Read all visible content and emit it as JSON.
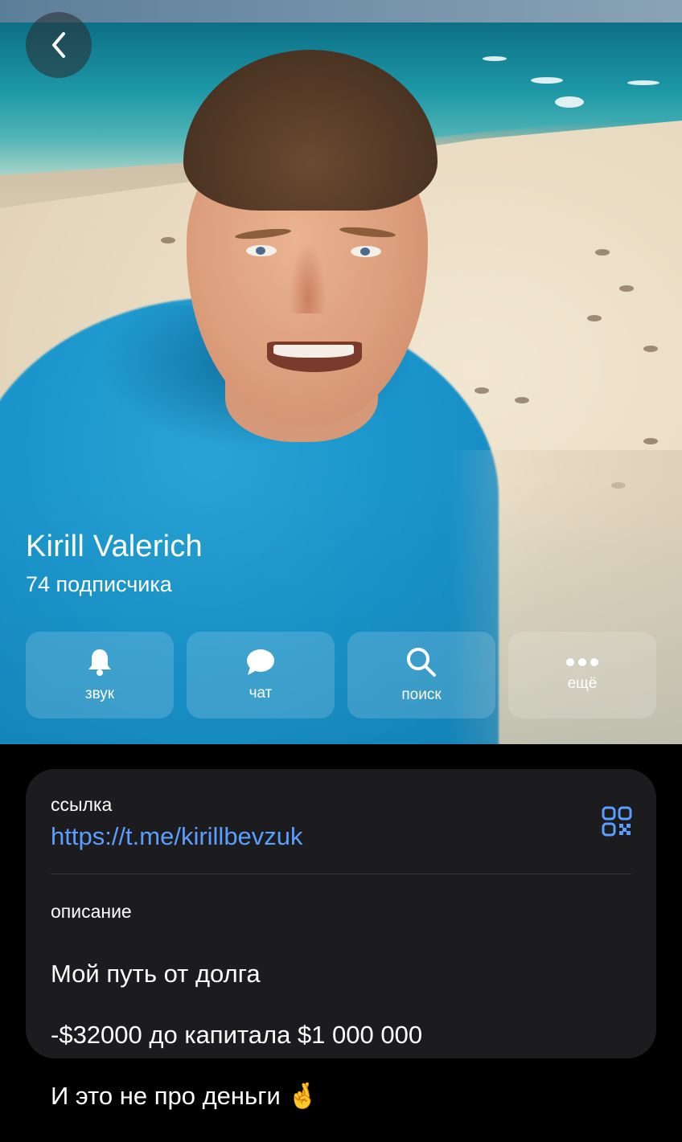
{
  "header": {
    "back_icon": "chevron-left-icon"
  },
  "profile": {
    "name": "Kirill Valerich",
    "subscribers": "74 подписчика"
  },
  "actions": [
    {
      "label": "звук",
      "icon": "bell-icon"
    },
    {
      "label": "чат",
      "icon": "chat-bubble-icon"
    },
    {
      "label": "поиск",
      "icon": "search-icon"
    },
    {
      "label": "ещё",
      "icon": "more-dots-icon"
    }
  ],
  "info": {
    "link_label": "ссылка",
    "link_url": "https://t.me/kirillbevzuk",
    "qr_icon": "qr-code-icon",
    "description_label": "описание",
    "description_lines": [
      "Мой путь от долга",
      "-$32000 до капитала $1 000 000",
      "И это не про деньги 🤞"
    ]
  },
  "colors": {
    "link": "#5a9eff",
    "card_bg": "#1c1c1e",
    "hoodie": "#1b96cc"
  }
}
